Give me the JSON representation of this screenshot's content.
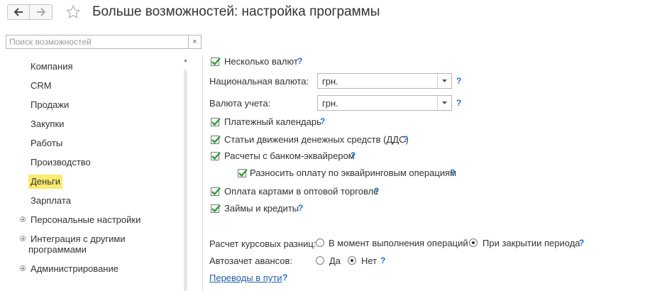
{
  "header": {
    "title": "Больше возможностей: настройка программы"
  },
  "search": {
    "placeholder": "Поиск возможностей",
    "clear_label": "×"
  },
  "sidebar": {
    "items": [
      {
        "label": "Компания"
      },
      {
        "label": "CRM"
      },
      {
        "label": "Продажи"
      },
      {
        "label": "Закупки"
      },
      {
        "label": "Работы"
      },
      {
        "label": "Производство"
      },
      {
        "label": "Деньги",
        "active": true
      },
      {
        "label": "Зарплата"
      }
    ],
    "groups": [
      {
        "label": "Персональные настройки"
      },
      {
        "label": "Интеграция с другими программами"
      },
      {
        "label": "Администрирование"
      }
    ]
  },
  "settings": {
    "multi_currency": {
      "label": "Несколько валют",
      "checked": true
    },
    "national_currency": {
      "label": "Национальная валюта:",
      "value": "грн."
    },
    "accounting_currency": {
      "label": "Валюта учета:",
      "value": "грн."
    },
    "payment_calendar": {
      "label": "Платежный календарь",
      "checked": true
    },
    "cash_flow_items": {
      "label": "Статьи движения денежных средств (ДДС)",
      "checked": true
    },
    "acquiring_bank": {
      "label": "Расчеты с банком-эквайрером",
      "checked": true
    },
    "acquiring_distribution": {
      "label": "Разносить оплату по эквайринговым операциям",
      "checked": true
    },
    "wholesale_card_payment": {
      "label": "Оплата картами в оптовой торговле",
      "checked": true
    },
    "loans_credits": {
      "label": "Займы и кредиты",
      "checked": true
    },
    "exchange_diff": {
      "label": "Расчет курсовых разниц:",
      "options": [
        "В момент выполнения операций",
        "При закрытии периода"
      ],
      "selected": "При закрытии периода"
    },
    "advance_offset": {
      "label": "Автозачет авансов:",
      "options": [
        "Да",
        "Нет"
      ],
      "selected": "Нет"
    },
    "transfers_link": {
      "label": "Переводы в пути"
    }
  },
  "help": {
    "mark": "?"
  },
  "colors": {
    "accent_link": "#1f5faa",
    "help": "#1f6fd1",
    "active_highlight": "#fbeb6e",
    "check": "#2e9c3f"
  }
}
